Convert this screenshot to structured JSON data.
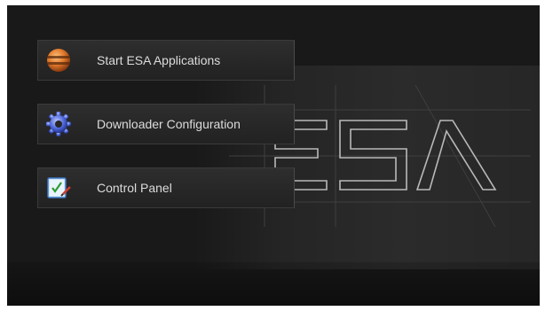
{
  "menu": {
    "items": [
      {
        "label": "Start ESA Applications",
        "icon": "esa-sphere-icon"
      },
      {
        "label": "Downloader Configuration",
        "icon": "gear-icon"
      },
      {
        "label": "Control Panel",
        "icon": "control-panel-icon"
      }
    ]
  },
  "logo": {
    "text": "ESA"
  },
  "colors": {
    "background": "#191919",
    "item_background": "#2a2a2a",
    "text": "#dcdcdc",
    "sphere_orange": "#e0782a"
  }
}
